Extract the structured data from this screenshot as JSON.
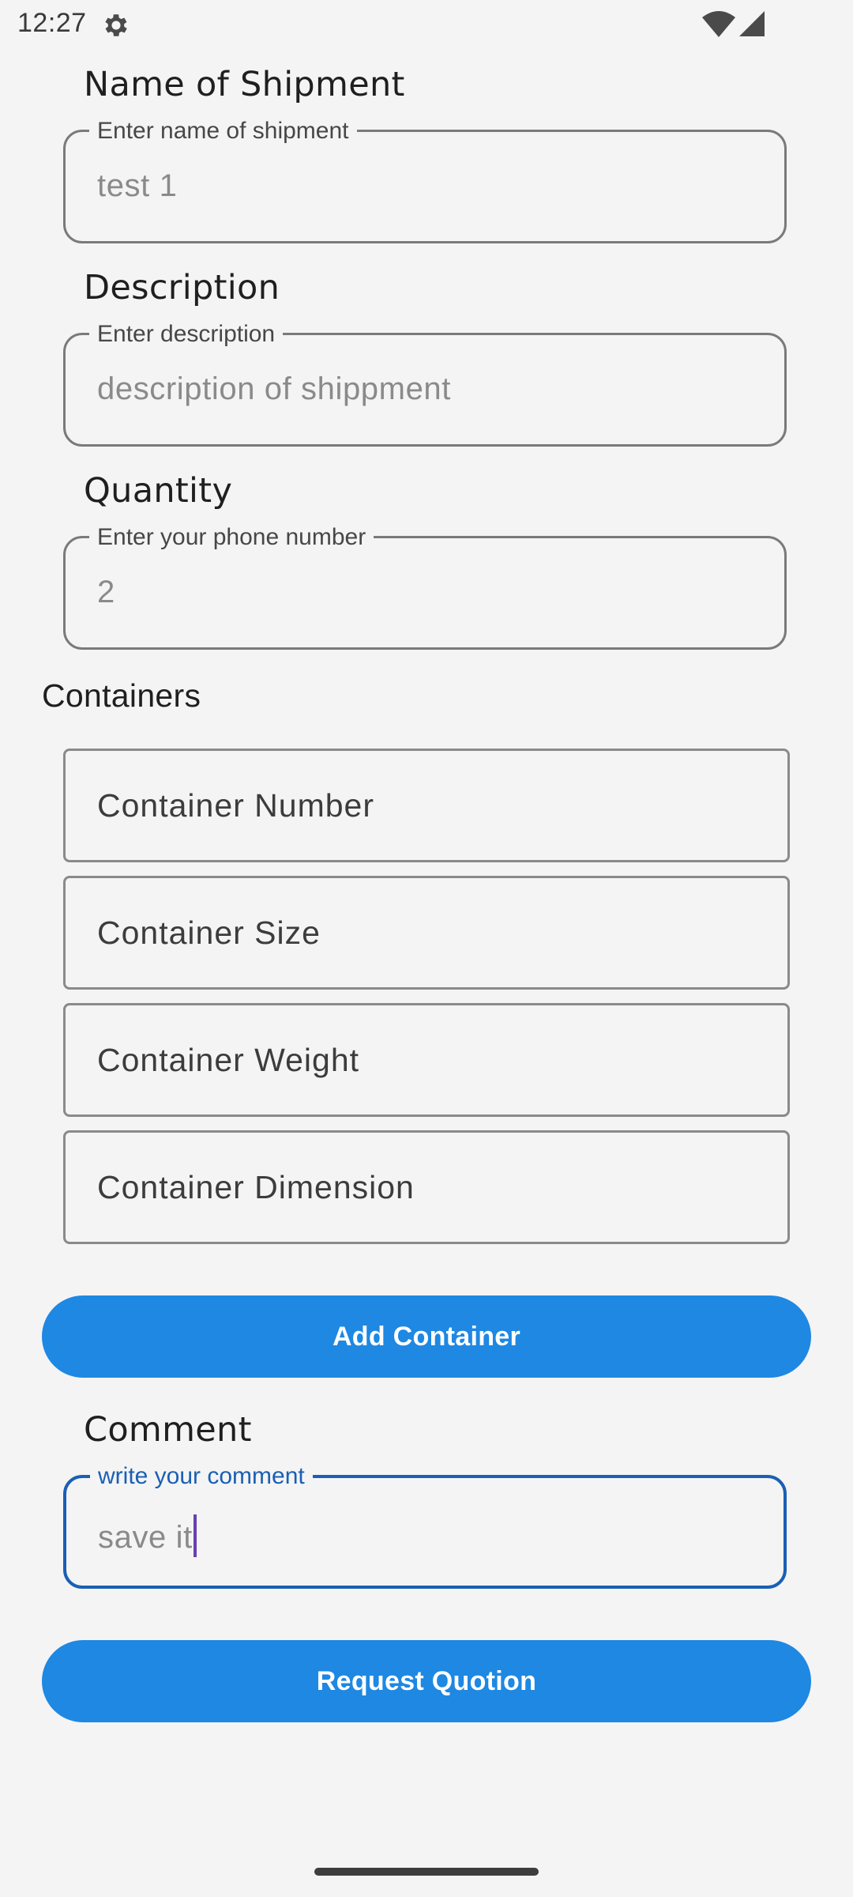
{
  "status_bar": {
    "time": "12:27",
    "icons": [
      "gear-icon",
      "wifi-icon",
      "signal-icon"
    ]
  },
  "form": {
    "shipment_name": {
      "section_label": "Name of Shipment",
      "field_label": "Enter name of shipment",
      "value": "test 1"
    },
    "description": {
      "section_label": "Description",
      "field_label": "Enter description",
      "value": "description of shippment"
    },
    "quantity": {
      "section_label": "Quantity",
      "field_label": "Enter your phone number",
      "value": "2"
    },
    "containers": {
      "section_label": "Containers",
      "fields": [
        {
          "placeholder": "Container Number"
        },
        {
          "placeholder": "Container Size"
        },
        {
          "placeholder": "Container Weight"
        },
        {
          "placeholder": "Container Dimension"
        }
      ],
      "add_button_label": "Add Container"
    },
    "comment": {
      "section_label": "Comment",
      "field_label": "write your comment",
      "value": "save it",
      "focused": true
    },
    "submit_button_label": "Request Quotion"
  },
  "colors": {
    "background": "#f4f4f4",
    "primary_button": "#1e88e2",
    "focused_outline": "#1a5fb4",
    "caret": "#6a3fb0"
  }
}
